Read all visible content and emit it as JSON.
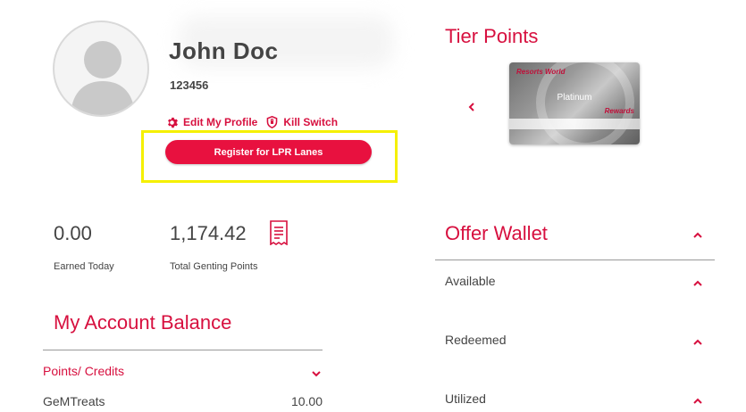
{
  "profile": {
    "name": "John Doc",
    "member_id": "123456",
    "edit_profile_label": "Edit My Profile",
    "kill_switch_label": "Kill Switch",
    "register_label": "Register for LPR Lanes"
  },
  "stats": {
    "earned_today_value": "0.00",
    "earned_today_label": "Earned Today",
    "total_points_value": "1,174.42",
    "total_points_label": "Total Genting Points"
  },
  "account_balance": {
    "title": "My Account Balance",
    "category_label": "Points/ Credits",
    "rows": [
      {
        "label": "GeMTreats",
        "value": "10.00"
      }
    ]
  },
  "tier_points": {
    "title": "Tier Points",
    "card_tier": "Platinum",
    "card_brand": "Resorts World",
    "card_program": "Rewards"
  },
  "offer_wallet": {
    "title": "Offer Wallet",
    "sections": [
      {
        "label": "Available"
      },
      {
        "label": "Redeemed"
      },
      {
        "label": "Utilized"
      }
    ]
  },
  "colors": {
    "accent": "#d7103f",
    "button": "#e8113f",
    "highlight": "#f5f000"
  }
}
